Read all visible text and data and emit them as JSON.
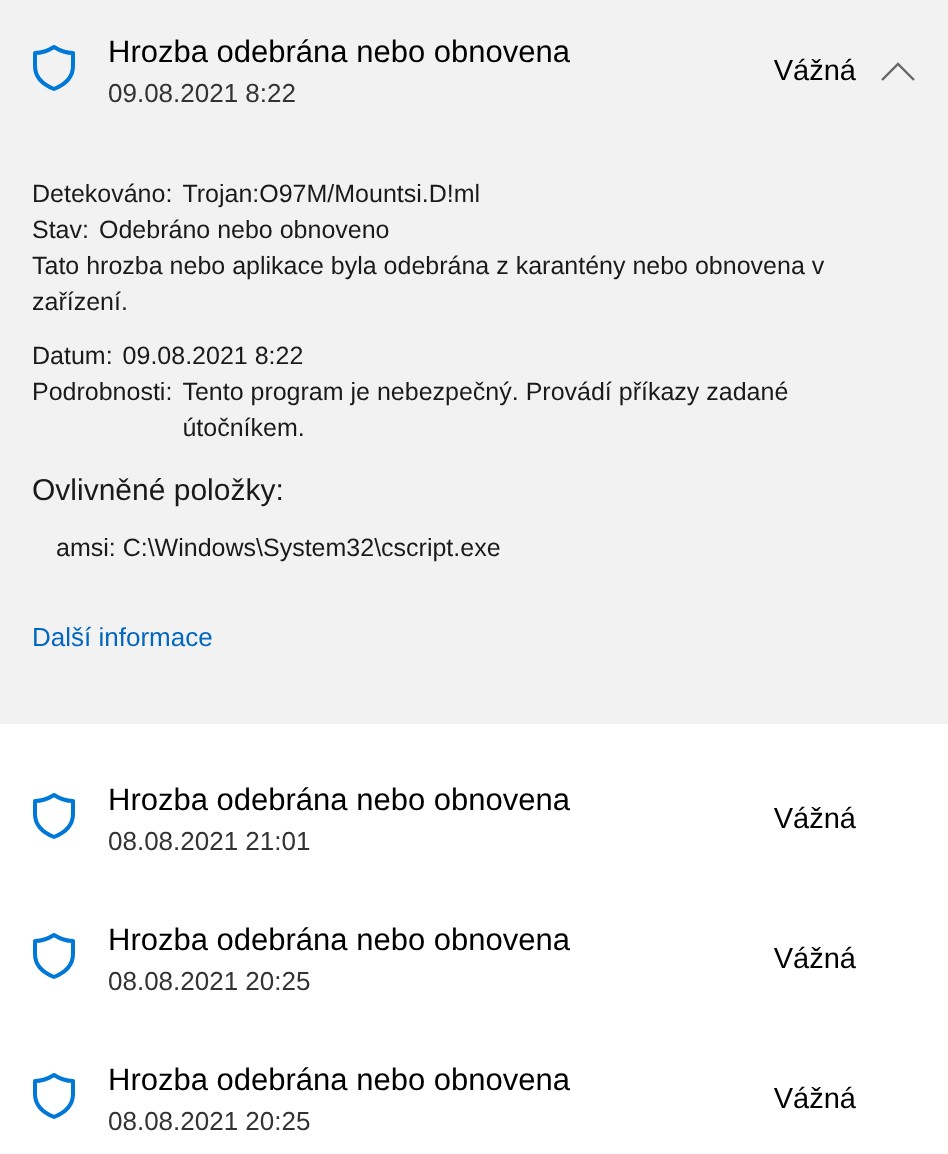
{
  "threats": [
    {
      "title": "Hrozba odebrána nebo obnovena",
      "date": "09.08.2021 8:22",
      "severity": "Vážná",
      "expanded": true,
      "details": {
        "fields": [
          {
            "label": "Detekováno:",
            "value": "Trojan:O97M/Mountsi.D!ml"
          },
          {
            "label": "Stav:",
            "value": "Odebráno nebo obnoveno"
          }
        ],
        "description": "Tato hrozba nebo aplikace byla odebrána z karantény nebo obnovena v zařízení.",
        "fields2": [
          {
            "label": "Datum:",
            "value": "09.08.2021 8:22"
          },
          {
            "label": "Podrobnosti:",
            "value": "Tento program je nebezpečný. Provádí příkazy zadané útočníkem."
          }
        ],
        "affected_heading": "Ovlivněné položky:",
        "affected_items": [
          "amsi: C:\\Windows\\System32\\cscript.exe"
        ],
        "link": "Další informace"
      }
    },
    {
      "title": "Hrozba odebrána nebo obnovena",
      "date": "08.08.2021 21:01",
      "severity": "Vážná",
      "expanded": false
    },
    {
      "title": "Hrozba odebrána nebo obnovena",
      "date": "08.08.2021 20:25",
      "severity": "Vážná",
      "expanded": false
    },
    {
      "title": "Hrozba odebrána nebo obnovena",
      "date": "08.08.2021 20:25",
      "severity": "Vážná",
      "expanded": false
    }
  ]
}
